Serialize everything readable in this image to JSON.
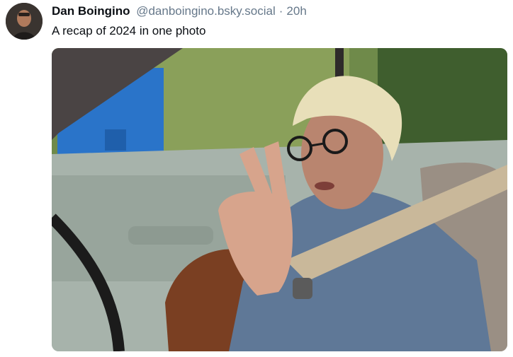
{
  "post": {
    "author": "Dan Boingino",
    "handle": "@danboingino.bsky.social",
    "separator": "·",
    "time": "20h",
    "text": "A recap of 2024 in one photo"
  },
  "icons": {
    "avatar": "profile-avatar",
    "image": "attached-photo"
  },
  "colors": {
    "text": "#0b0f14",
    "muted": "#66788a",
    "background": "#ffffff"
  }
}
